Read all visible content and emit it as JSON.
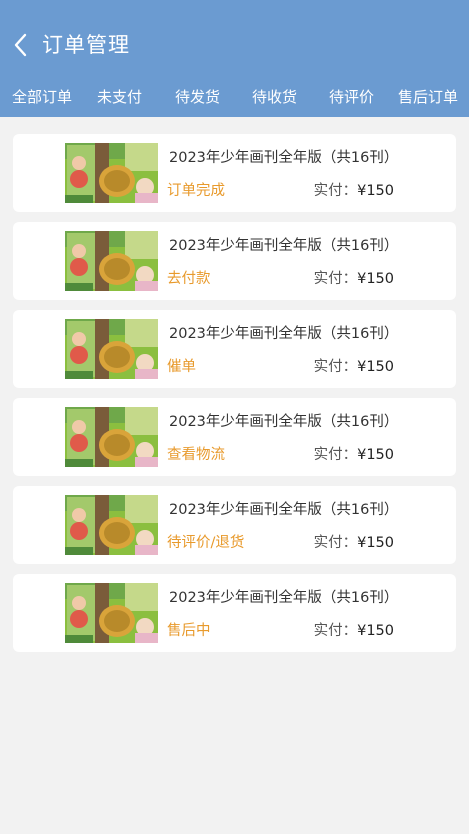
{
  "header": {
    "title": "订单管理",
    "back_icon": "chevron-left-icon",
    "background_color": "#6b9bd1"
  },
  "tabs": [
    {
      "label": "全部订单"
    },
    {
      "label": "未支付"
    },
    {
      "label": "待发货"
    },
    {
      "label": "待收货"
    },
    {
      "label": "待评价"
    },
    {
      "label": "售后订单"
    }
  ],
  "orders": [
    {
      "title": "2023年少年画刊全年版（共16刊）",
      "status": "订单完成",
      "price_label": "实付：",
      "price": "¥150"
    },
    {
      "title": "2023年少年画刊全年版（共16刊）",
      "status": "去付款",
      "price_label": "实付：",
      "price": "¥150"
    },
    {
      "title": "2023年少年画刊全年版（共16刊）",
      "status": "催单",
      "price_label": "实付：",
      "price": "¥150"
    },
    {
      "title": "2023年少年画刊全年版（共16刊）",
      "status": "查看物流",
      "price_label": "实付：",
      "price": "¥150"
    },
    {
      "title": "2023年少年画刊全年版（共16刊）",
      "status": "待评价/退货",
      "price_label": "实付：",
      "price": "¥150"
    },
    {
      "title": "2023年少年画刊全年版（共16刊）",
      "status": "售后中",
      "price_label": "实付：",
      "price": "¥150"
    }
  ],
  "colors": {
    "accent": "#e89a2c",
    "page_background": "#f2f2f2",
    "card_background": "#ffffff"
  }
}
